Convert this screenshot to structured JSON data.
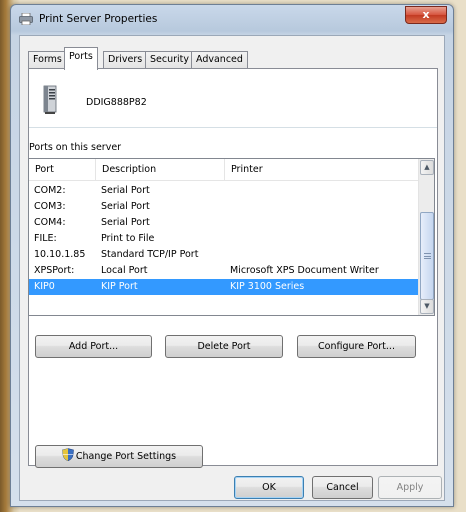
{
  "window": {
    "title": "Print Server Properties",
    "close_label": "x"
  },
  "tabs": [
    {
      "label": "Forms",
      "active": false
    },
    {
      "label": "Ports",
      "active": true
    },
    {
      "label": "Drivers",
      "active": false
    },
    {
      "label": "Security",
      "active": false
    },
    {
      "label": "Advanced",
      "active": false
    }
  ],
  "server": {
    "name": "DDIG888P82",
    "icon": "server-icon"
  },
  "ports_section": {
    "label": "Ports on this server",
    "columns": [
      "Port",
      "Description",
      "Printer"
    ],
    "rows": [
      {
        "port": "COM2:",
        "description": "Serial Port",
        "printer": ""
      },
      {
        "port": "COM3:",
        "description": "Serial Port",
        "printer": ""
      },
      {
        "port": "COM4:",
        "description": "Serial Port",
        "printer": ""
      },
      {
        "port": "FILE:",
        "description": "Print to File",
        "printer": ""
      },
      {
        "port": "10.10.1.85",
        "description": "Standard TCP/IP Port",
        "printer": ""
      },
      {
        "port": "XPSPort:",
        "description": "Local Port",
        "printer": "Microsoft XPS Document Writer"
      },
      {
        "port": "KIP0",
        "description": "KIP Port",
        "printer": "KIP 3100 Series",
        "selected": true
      }
    ]
  },
  "actions": {
    "add_port": "Add Port...",
    "delete_port": "Delete Port",
    "configure_port": "Configure Port...",
    "change_settings": "Change Port Settings"
  },
  "footer": {
    "ok": "OK",
    "cancel": "Cancel",
    "apply": "Apply"
  },
  "colors": {
    "selection": "#3399ff",
    "close_button": "#c23a22"
  }
}
